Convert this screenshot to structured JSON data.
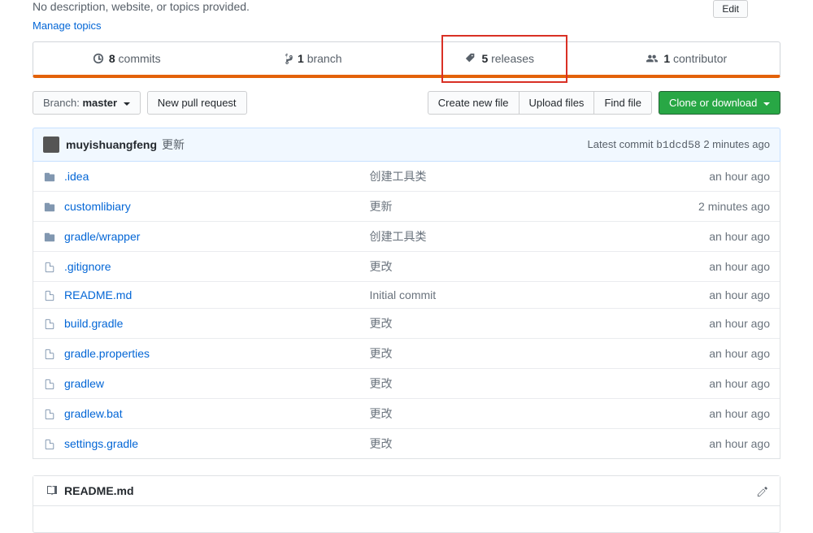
{
  "header": {
    "description": "No description, website, or topics provided.",
    "manage_topics": "Manage topics",
    "edit_label": "Edit"
  },
  "stats": {
    "commits": {
      "count": "8",
      "label": "commits"
    },
    "branches": {
      "count": "1",
      "label": "branch"
    },
    "releases": {
      "count": "5",
      "label": "releases"
    },
    "contributors": {
      "count": "1",
      "label": "contributor"
    }
  },
  "toolbar": {
    "branch_prefix": "Branch:",
    "branch_name": "master",
    "new_pr": "New pull request",
    "create_file": "Create new file",
    "upload_files": "Upload files",
    "find_file": "Find file",
    "clone": "Clone or download"
  },
  "latest_commit": {
    "author": "muyishuangfeng",
    "message": "更新",
    "meta_prefix": "Latest commit",
    "hash": "b1dcd58",
    "time": "2 minutes ago"
  },
  "files": [
    {
      "type": "folder",
      "name": ".idea",
      "msg": "创建工具类",
      "time": "an hour ago"
    },
    {
      "type": "folder",
      "name": "customlibiary",
      "msg": "更新",
      "time": "2 minutes ago"
    },
    {
      "type": "folder",
      "name": "gradle/wrapper",
      "msg": "创建工具类",
      "time": "an hour ago"
    },
    {
      "type": "file",
      "name": ".gitignore",
      "msg": "更改",
      "time": "an hour ago"
    },
    {
      "type": "file",
      "name": "README.md",
      "msg": "Initial commit",
      "time": "an hour ago"
    },
    {
      "type": "file",
      "name": "build.gradle",
      "msg": "更改",
      "time": "an hour ago"
    },
    {
      "type": "file",
      "name": "gradle.properties",
      "msg": "更改",
      "time": "an hour ago"
    },
    {
      "type": "file",
      "name": "gradlew",
      "msg": "更改",
      "time": "an hour ago"
    },
    {
      "type": "file",
      "name": "gradlew.bat",
      "msg": "更改",
      "time": "an hour ago"
    },
    {
      "type": "file",
      "name": "settings.gradle",
      "msg": "更改",
      "time": "an hour ago"
    }
  ],
  "readme": {
    "filename": "README.md"
  }
}
